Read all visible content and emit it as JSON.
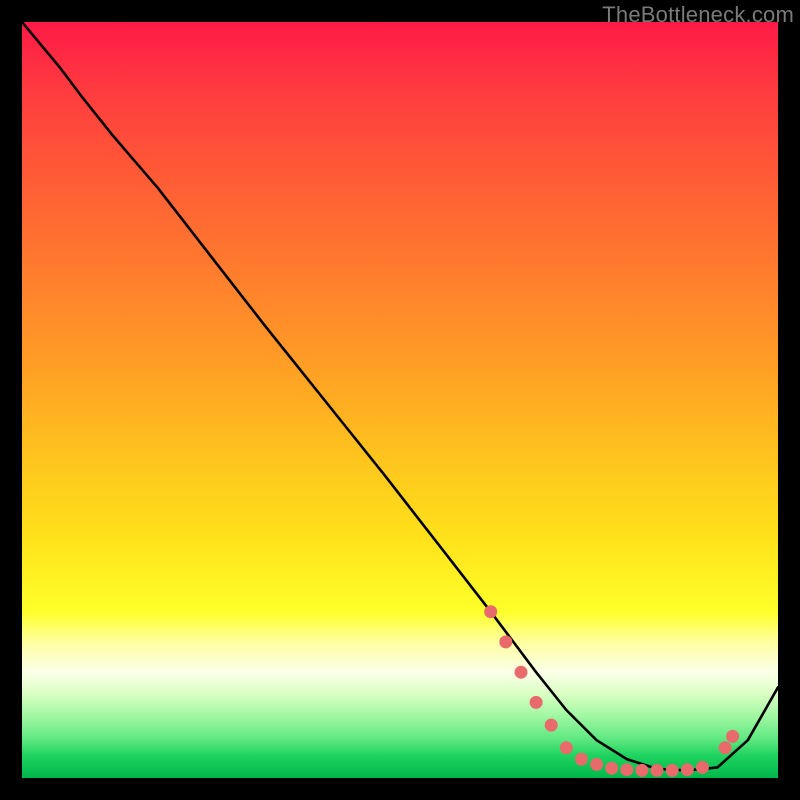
{
  "watermark": "TheBottleneck.com",
  "colors": {
    "background": "#000000",
    "curve": "#000000",
    "marker_fill": "#e86a6a",
    "marker_stroke": "#c24f4f"
  },
  "chart_data": {
    "type": "line",
    "title": "",
    "xlabel": "",
    "ylabel": "",
    "xlim": [
      0,
      100
    ],
    "ylim": [
      0,
      100
    ],
    "grid": false,
    "legend": false,
    "series": [
      {
        "name": "curve",
        "x": [
          0,
          5,
          8,
          12,
          18,
          25,
          32,
          40,
          48,
          55,
          62,
          68,
          72,
          76,
          80,
          84,
          88,
          92,
          96,
          100
        ],
        "y": [
          100,
          94,
          90,
          85,
          78,
          69,
          60,
          50,
          40,
          31,
          22,
          14,
          9,
          5,
          2.5,
          1.2,
          1.0,
          1.4,
          5,
          12
        ]
      }
    ],
    "markers": [
      {
        "x": 62,
        "y": 22
      },
      {
        "x": 64,
        "y": 18
      },
      {
        "x": 66,
        "y": 14
      },
      {
        "x": 68,
        "y": 10
      },
      {
        "x": 70,
        "y": 7
      },
      {
        "x": 72,
        "y": 4
      },
      {
        "x": 74,
        "y": 2.5
      },
      {
        "x": 76,
        "y": 1.8
      },
      {
        "x": 78,
        "y": 1.3
      },
      {
        "x": 80,
        "y": 1.1
      },
      {
        "x": 82,
        "y": 1.0
      },
      {
        "x": 84,
        "y": 1.0
      },
      {
        "x": 86,
        "y": 1.0
      },
      {
        "x": 88,
        "y": 1.1
      },
      {
        "x": 90,
        "y": 1.4
      },
      {
        "x": 93,
        "y": 4.0
      },
      {
        "x": 94,
        "y": 5.5
      }
    ]
  }
}
